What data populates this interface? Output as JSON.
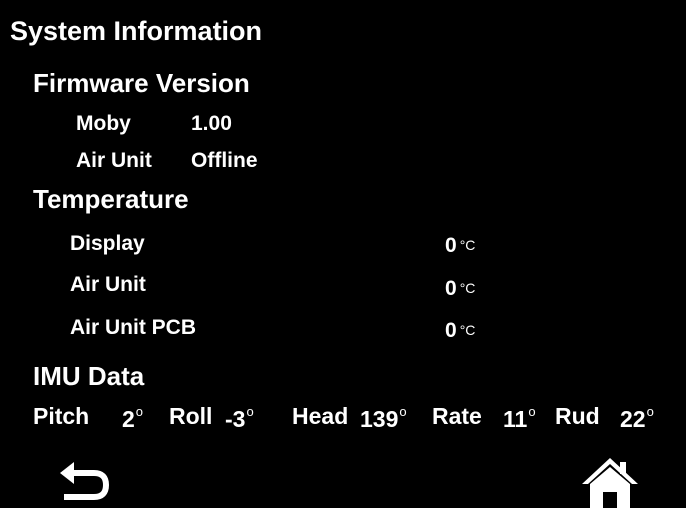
{
  "screen": {
    "title": "System Information"
  },
  "firmware": {
    "heading": "Firmware Version",
    "moby_label": "Moby",
    "moby_value": "1.00",
    "air_unit_label": "Air Unit",
    "air_unit_value": "Offline"
  },
  "temperature": {
    "heading": "Temperature",
    "unit": "°C",
    "rows": [
      {
        "label": "Display",
        "value": "0"
      },
      {
        "label": "Air Unit",
        "value": "0"
      },
      {
        "label": "Air Unit PCB",
        "value": "0"
      }
    ]
  },
  "imu": {
    "heading": "IMU Data",
    "degree_symbol": "o",
    "items": [
      {
        "label": "Pitch",
        "value": "2"
      },
      {
        "label": "Roll",
        "value": "-3"
      },
      {
        "label": "Head",
        "value": "139"
      },
      {
        "label": "Rate",
        "value": "11"
      },
      {
        "label": "Rud",
        "value": "22"
      }
    ]
  },
  "nav": {
    "back_icon": "back-arrow-icon",
    "home_icon": "home-icon"
  },
  "colors": {
    "background": "#000000",
    "text": "#ffffff"
  }
}
